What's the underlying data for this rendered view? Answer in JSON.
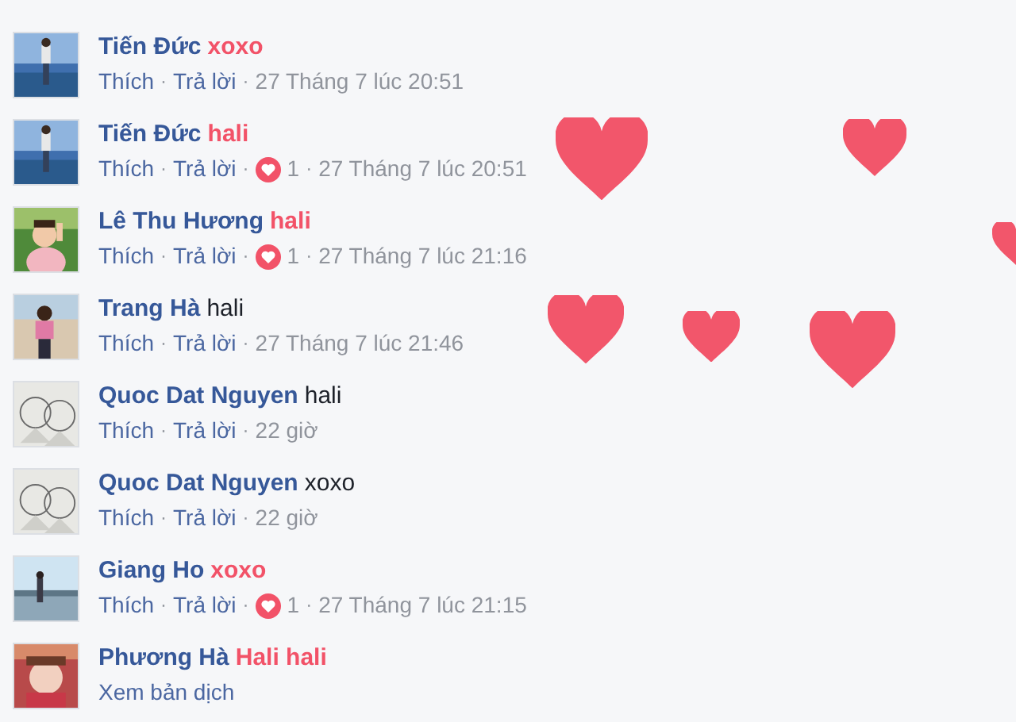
{
  "separator": "·",
  "comments": [
    {
      "author": "Tiến Đức",
      "text": "xoxo",
      "highlighted": true,
      "actions": [
        "Thích",
        "Trả lời"
      ],
      "time": "27 Tháng 7 lúc 20:51"
    },
    {
      "author": "Tiến Đức",
      "text": "hali",
      "highlighted": true,
      "actions": [
        "Thích",
        "Trả lời"
      ],
      "reactions": "1",
      "time": "27 Tháng 7 lúc 20:51"
    },
    {
      "author": "Lê Thu Hương",
      "text": "hali",
      "highlighted": true,
      "actions": [
        "Thích",
        "Trả lời"
      ],
      "reactions": "1",
      "time": "27 Tháng 7 lúc 21:16"
    },
    {
      "author": "Trang Hà",
      "text": "hali",
      "highlighted": false,
      "actions": [
        "Thích",
        "Trả lời"
      ],
      "time": "27 Tháng 7 lúc 21:46"
    },
    {
      "author": "Quoc Dat Nguyen",
      "text": "hali",
      "highlighted": false,
      "actions": [
        "Thích",
        "Trả lời"
      ],
      "time": "22 giờ"
    },
    {
      "author": "Quoc Dat Nguyen",
      "text": "xoxo",
      "highlighted": false,
      "actions": [
        "Thích",
        "Trả lời"
      ],
      "time": "22 giờ"
    },
    {
      "author": "Giang Ho",
      "text": "xoxo",
      "highlighted": true,
      "actions": [
        "Thích",
        "Trả lời"
      ],
      "reactions": "1",
      "time": "27 Tháng 7 lúc 21:15"
    },
    {
      "author": "Phương Hà",
      "text": "Hali hali",
      "highlighted": true,
      "translate_link": "Xem bản dịch"
    }
  ]
}
